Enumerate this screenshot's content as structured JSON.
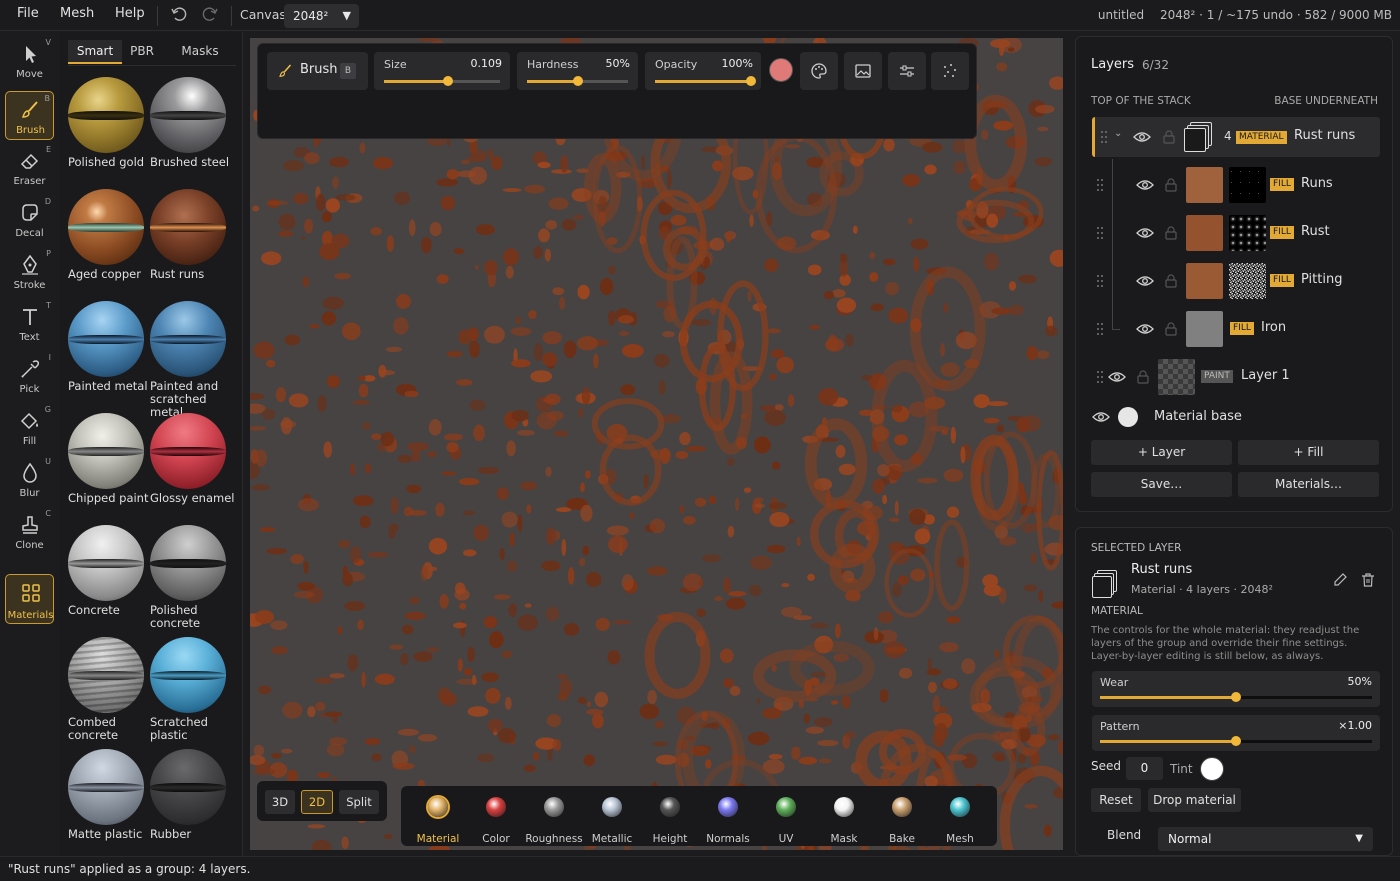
{
  "menu": {
    "file": "File",
    "mesh": "Mesh",
    "help": "Help"
  },
  "canvas": {
    "label": "Canvas",
    "value": "2048²"
  },
  "doc": {
    "name": "untitled",
    "info": "2048² · 1 / ~175 undo · 582 / 9000 MB"
  },
  "tools": [
    {
      "label": "Move",
      "key": "V",
      "icon": "cursor-icon"
    },
    {
      "label": "Brush",
      "key": "B",
      "icon": "brush-icon"
    },
    {
      "label": "Eraser",
      "key": "E",
      "icon": "eraser-icon"
    },
    {
      "label": "Decal",
      "key": "D",
      "icon": "decal-icon"
    },
    {
      "label": "Stroke",
      "key": "P",
      "icon": "pen-icon"
    },
    {
      "label": "Text",
      "key": "T",
      "icon": "text-icon"
    },
    {
      "label": "Pick",
      "key": "I",
      "icon": "eyedropper-icon"
    },
    {
      "label": "Fill",
      "key": "G",
      "icon": "fill-bucket-icon"
    },
    {
      "label": "Blur",
      "key": "U",
      "icon": "droplet-icon"
    },
    {
      "label": "Clone",
      "key": "C",
      "icon": "stamp-icon"
    },
    {
      "label": "Materials",
      "key": "",
      "icon": "grid-icon"
    }
  ],
  "library": {
    "tabs": [
      "Smart",
      "PBR",
      "Masks"
    ],
    "active_tab": "Smart",
    "materials": [
      "Polished gold",
      "Brushed steel",
      "Aged copper",
      "Rust runs",
      "Painted metal",
      "Painted and scratched metal",
      "Chipped paint",
      "Glossy enamel",
      "Concrete",
      "Polished concrete",
      "Combed concrete",
      "Scratched plastic",
      "Matte plastic",
      "Rubber"
    ]
  },
  "toolbar": {
    "brush_label": "Brush",
    "brush_key": "B",
    "size_label": "Size",
    "size_value": "0.109",
    "size_level": 0.55,
    "hardness_label": "Hardness",
    "hardness_value": "50%",
    "hardness_level": 0.5,
    "opacity_label": "Opacity",
    "opacity_value": "100%",
    "opacity_level": 1.0,
    "color": "#e07a78",
    "icons": [
      "palette-icon",
      "image-icon",
      "sliders-icon",
      "scatter-icon"
    ]
  },
  "viewmodes": [
    "3D",
    "2D",
    "Split"
  ],
  "active_viewmode": "2D",
  "channels": [
    {
      "label": "Material",
      "color": "#e2b46a"
    },
    {
      "label": "Color",
      "color": "#d94040"
    },
    {
      "label": "Roughness",
      "color": "#9a9a9a"
    },
    {
      "label": "Metallic",
      "color": "#b8c4d4"
    },
    {
      "label": "Height",
      "color": "#555555"
    },
    {
      "label": "Normals",
      "color": "#7a78f0"
    },
    {
      "label": "UV",
      "color": "#5fb05a"
    },
    {
      "label": "Mask",
      "color": "#f4f4f4"
    },
    {
      "label": "Bake",
      "color": "#c9a070"
    },
    {
      "label": "Mesh",
      "color": "#4cc4d0"
    }
  ],
  "layers": {
    "title": "Layers",
    "count": "6/32",
    "top_label": "TOP OF THE STACK",
    "base_label": "BASE UNDERNEATH",
    "group": {
      "count": "4",
      "badge": "MATERIAL",
      "name": "Rust runs"
    },
    "items": [
      {
        "badge": "FILL",
        "name": "Runs"
      },
      {
        "badge": "FILL",
        "name": "Rust"
      },
      {
        "badge": "FILL",
        "name": "Pitting"
      },
      {
        "badge": "FILL",
        "name": "Iron"
      }
    ],
    "paint": {
      "badge": "PAINT",
      "name": "Layer 1"
    },
    "base": {
      "name": "Material base"
    },
    "buttons": [
      "+ Layer",
      "+ Fill",
      "Save…",
      "Materials…"
    ]
  },
  "selected": {
    "header": "SELECTED LAYER",
    "name": "Rust runs",
    "meta": "Material · 4 layers · 2048²",
    "section": "MATERIAL",
    "desc": "The controls for the whole material: they readjust the layers of the group and override their fine settings. Layer-by-layer editing is still below, as always.",
    "wear_label": "Wear",
    "wear_value": "50%",
    "wear_level": 0.5,
    "pattern_label": "Pattern",
    "pattern_value": "×1.00",
    "pattern_level": 0.5,
    "seed_label": "Seed",
    "seed_value": "0",
    "tint_label": "Tint",
    "reset": "Reset",
    "drop": "Drop material",
    "blend_label": "Blend",
    "blend_value": "Normal"
  },
  "status": "\"Rust runs\" applied as a group: 4 layers."
}
